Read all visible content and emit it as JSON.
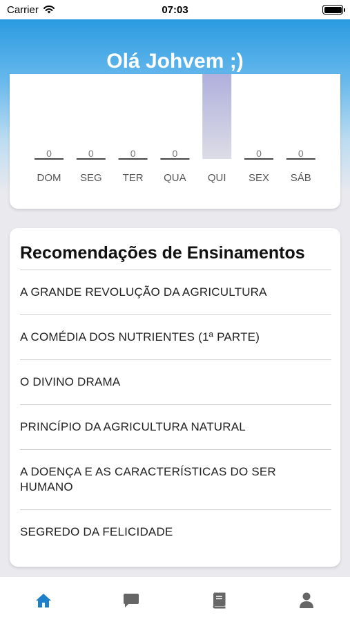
{
  "status_bar": {
    "carrier": "Carrier",
    "time": "07:03"
  },
  "header": {
    "greeting": "Olá Johvem ;)"
  },
  "chart_data": {
    "type": "bar",
    "categories": [
      "DOM",
      "SEG",
      "TER",
      "QUA",
      "QUI",
      "SEX",
      "SÁB"
    ],
    "values": [
      0,
      0,
      0,
      0,
      1,
      0,
      0
    ],
    "value_labels": [
      "0",
      "0",
      "0",
      "0",
      "",
      "0",
      "0"
    ],
    "ylim": [
      0,
      1
    ],
    "bar_color_top": "#b0b0dd",
    "bar_color_bottom": "#dcdce6",
    "grid": false
  },
  "recommendations": {
    "title": "Recomendações de Ensinamentos",
    "items": [
      "A GRANDE REVOLUÇÃO DA AGRICULTURA",
      "A COMÉDIA DOS NUTRIENTES (1ª PARTE)",
      "O DIVINO DRAMA",
      "PRINCÍPIO DA AGRICULTURA NATURAL",
      "A DOENÇA E AS CARACTERÍSTICAS DO SER HUMANO",
      "SEGREDO DA FELICIDADE"
    ]
  },
  "tab_bar": {
    "tabs": [
      {
        "icon": "home-icon",
        "active": true
      },
      {
        "icon": "chat-icon",
        "active": false
      },
      {
        "icon": "book-icon",
        "active": false
      },
      {
        "icon": "profile-icon",
        "active": false
      }
    ],
    "active_color": "#1e7fcb",
    "inactive_color": "#666666"
  }
}
